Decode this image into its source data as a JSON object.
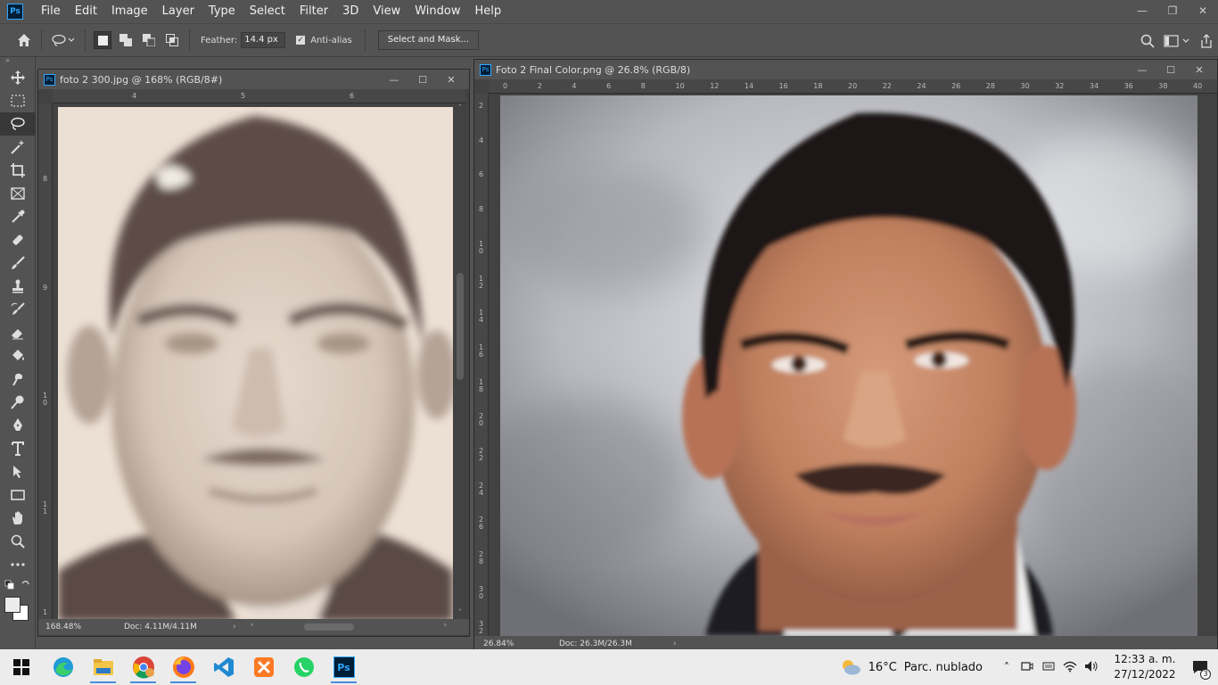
{
  "menubar": {
    "logo": "Ps",
    "items": [
      "File",
      "Edit",
      "Image",
      "Layer",
      "Type",
      "Select",
      "Filter",
      "3D",
      "View",
      "Window",
      "Help"
    ]
  },
  "options": {
    "feather_label": "Feather:",
    "feather_value": "14.4 px",
    "antialias_label": "Anti-alias",
    "antialias_checked": true,
    "select_mask_label": "Select and Mask..."
  },
  "doc1": {
    "icon": "Ps",
    "title": "foto 2 300.jpg @ 168% (RGB/8#)",
    "ruler_h": [
      "4",
      "5",
      "6"
    ],
    "ruler_v": [
      "8",
      "9",
      "1 0",
      "1 1",
      "1"
    ],
    "zoom": "168.48%",
    "doc_size": "Doc: 4.11M/4.11M"
  },
  "doc2": {
    "icon": "Ps",
    "title": "Foto 2 Final Color.png @ 26.8% (RGB/8)",
    "ruler_h": [
      "0",
      "2",
      "4",
      "6",
      "8",
      "10",
      "12",
      "14",
      "16",
      "18",
      "20",
      "22",
      "24",
      "26",
      "28",
      "30",
      "32",
      "34",
      "36",
      "38",
      "40"
    ],
    "ruler_v": [
      "2",
      "4",
      "6",
      "8",
      "1 0",
      "1 2",
      "1 4",
      "1 6",
      "1 8",
      "2 0",
      "2 2",
      "2 4",
      "2 6",
      "2 8",
      "3 0",
      "3 2"
    ],
    "zoom": "26.84%",
    "doc_size": "Doc: 26.3M/26.3M"
  },
  "taskbar": {
    "temperature": "16°C",
    "weather": "Parc. nublado",
    "time": "12:33 a. m.",
    "date": "27/12/2022",
    "notifications": "3",
    "ps_label": "Ps"
  },
  "colors": {
    "accent": "#31a8ff",
    "panel": "#535353",
    "canvas_bg": "#424242"
  }
}
